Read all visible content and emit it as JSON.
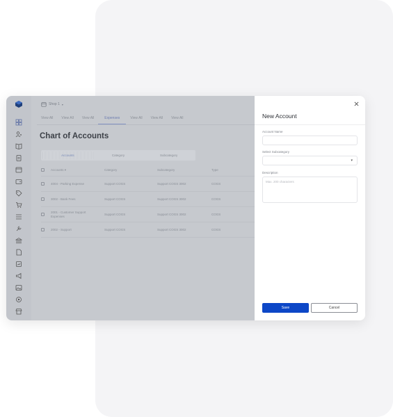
{
  "header": {
    "store_label": "Shop 1"
  },
  "tabs": [
    {
      "label": "View All"
    },
    {
      "label": "View All"
    },
    {
      "label": "View All"
    },
    {
      "label": "Expenses"
    },
    {
      "label": "View All"
    },
    {
      "label": "View All"
    },
    {
      "label": "View All"
    }
  ],
  "page": {
    "title": "Chart of Accounts"
  },
  "segments": [
    {
      "label": "Accounts"
    },
    {
      "label": "Category"
    },
    {
      "label": "Subcategory"
    }
  ],
  "table": {
    "headers": [
      "Accounts",
      "Category",
      "Subcategory",
      "Type"
    ],
    "rows": [
      [
        "4004 - Parking Expense",
        "Support COGS",
        "Support COGS 3002",
        "COGS"
      ],
      [
        "3002 - Bank Fees",
        "Support COGS",
        "Support COGS 3002",
        "COGS"
      ],
      [
        "2001 - Customer Support Expenses",
        "Support COGS",
        "Support COGS 3002",
        "COGS"
      ],
      [
        "2002 - Support",
        "Support COGS",
        "Support COGS 3002",
        "COGS"
      ]
    ]
  },
  "drawer": {
    "title": "New Account",
    "account_name_label": "Account Name",
    "account_name_value": "",
    "subcategory_label": "Select Subcategory",
    "subcategory_value": "",
    "description_label": "Description",
    "description_placeholder": "Max. 200 characters",
    "save_label": "Save",
    "cancel_label": "Cancel"
  },
  "colors": {
    "primary": "#0d47c7",
    "overlay": "#c6c9ce"
  },
  "sidebar_icons": [
    "logo-icon",
    "dashboard-icon",
    "users-icon",
    "book-icon",
    "clipboard-icon",
    "calendar-icon",
    "wallet-icon",
    "tag-icon",
    "cart-icon",
    "list-icon",
    "tool-icon",
    "bank-icon",
    "document-icon",
    "report-icon",
    "megaphone-icon",
    "image-icon",
    "settings-icon",
    "store-icon"
  ]
}
